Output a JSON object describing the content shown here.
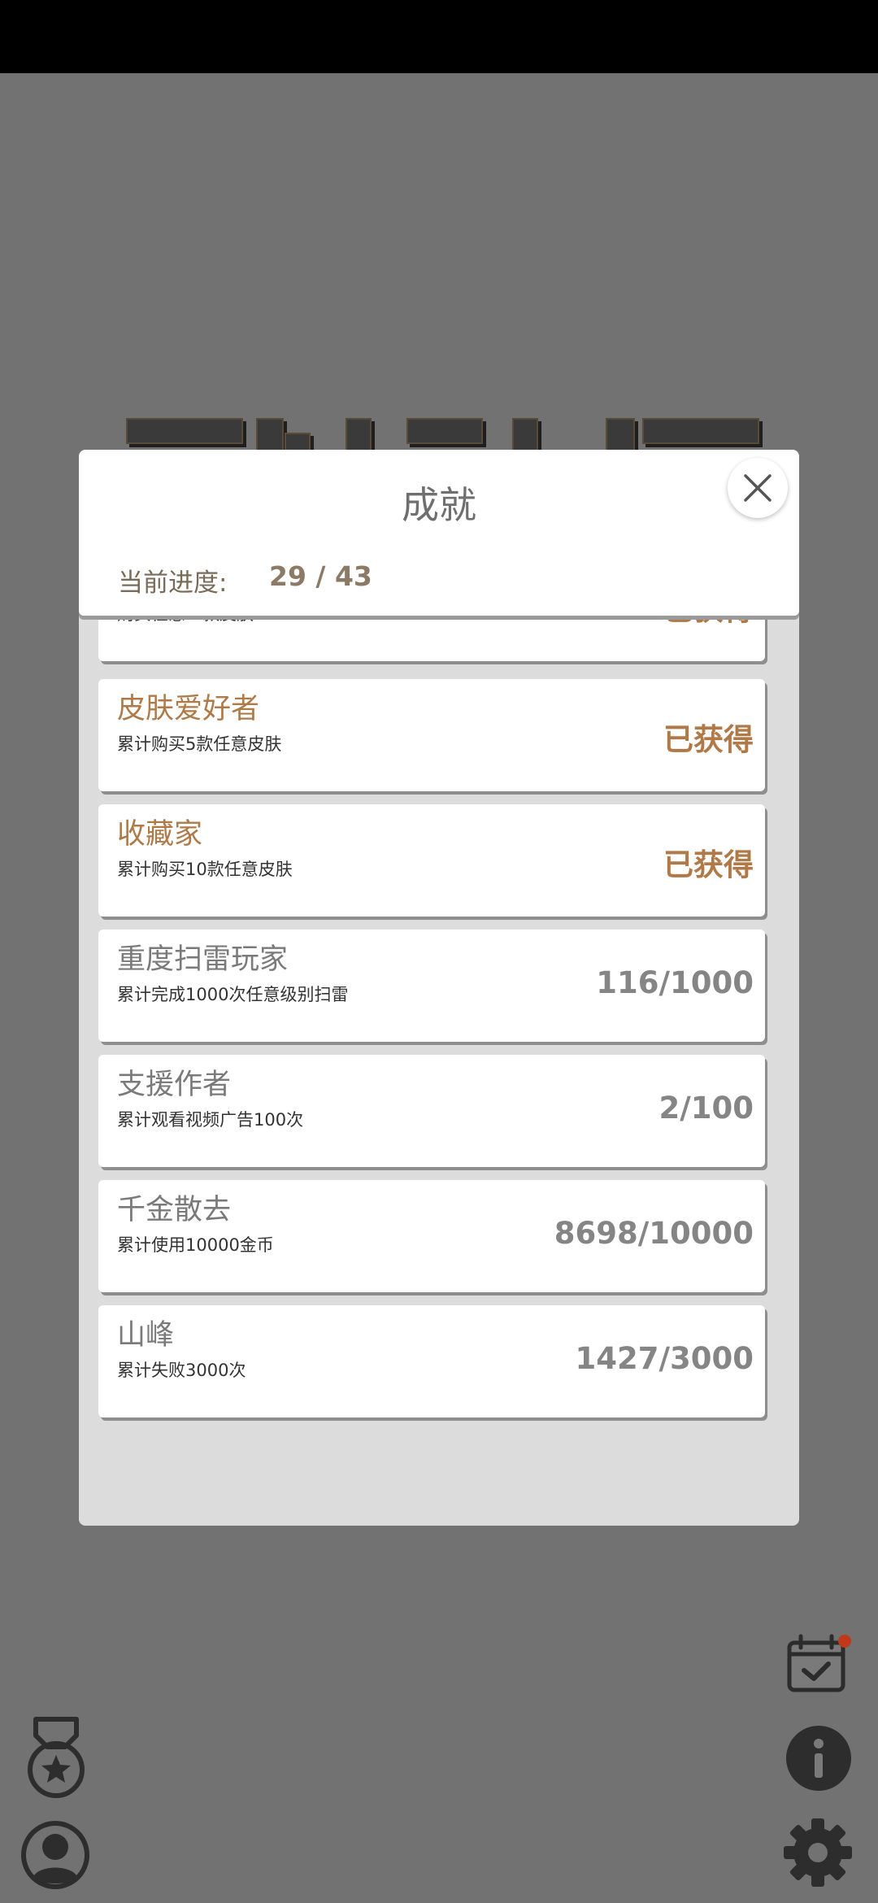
{
  "dialog": {
    "title": "成就",
    "progress_label": "当前进度:",
    "progress_value": "29 / 43"
  },
  "achievements": [
    {
      "name": "",
      "desc": "购买任意一款皮肤",
      "status": "已获得",
      "earned": true
    },
    {
      "name": "皮肤爱好者",
      "desc": "累计购买5款任意皮肤",
      "status": "已获得",
      "earned": true
    },
    {
      "name": "收藏家",
      "desc": "累计购买10款任意皮肤",
      "status": "已获得",
      "earned": true
    },
    {
      "name": "重度扫雷玩家",
      "desc": "累计完成1000次任意级别扫雷",
      "status": "116/1000",
      "earned": false
    },
    {
      "name": "支援作者",
      "desc": "累计观看视频广告100次",
      "status": "2/100",
      "earned": false
    },
    {
      "name": "千金散去",
      "desc": "累计使用10000金币",
      "status": "8698/10000",
      "earned": false
    },
    {
      "name": "山峰",
      "desc": "累计失败3000次",
      "status": "1427/3000",
      "earned": false
    }
  ],
  "icons": {
    "close": "close-icon",
    "calendar": "calendar-check-icon",
    "info": "info-icon",
    "settings": "gear-icon",
    "medal": "medal-icon",
    "profile": "profile-icon"
  },
  "colors": {
    "earned": "#b07a48",
    "notification_dot": "#c0391b"
  }
}
